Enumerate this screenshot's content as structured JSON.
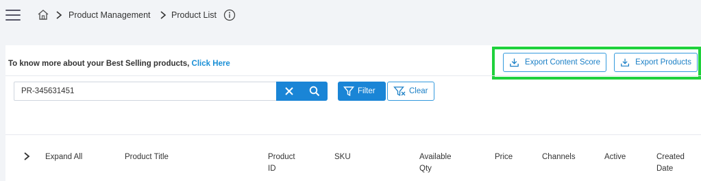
{
  "header": {
    "breadcrumb": [
      "Product Management",
      "Product List"
    ]
  },
  "banner": {
    "text": "To know more about your Best Selling products,",
    "link": "Click Here"
  },
  "toolbar": {
    "export_content_score": "Export Content Score",
    "export_products": "Export Products",
    "highlight_color": "#1fd13c"
  },
  "search": {
    "value": "PR-345631451"
  },
  "filters": {
    "filter_label": "Filter",
    "clear_label": "Clear"
  },
  "table": {
    "expand_all": "Expand All",
    "columns": {
      "product_title": "Product Title",
      "product_id_line1": "Product",
      "product_id_line2": "ID",
      "sku": "SKU",
      "available_qty_line1": "Available",
      "available_qty_line2": "Qty",
      "price": "Price",
      "channels": "Channels",
      "active": "Active",
      "created_date_line1": "Created",
      "created_date_line2": "Date"
    }
  },
  "colors": {
    "primary": "#1a85d6",
    "link": "#1a8fd6"
  }
}
